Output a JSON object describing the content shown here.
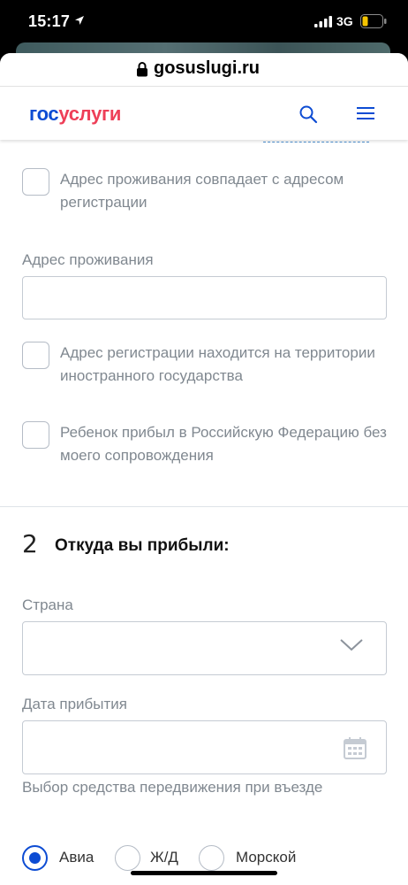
{
  "status_bar": {
    "time": "15:17",
    "network": "3G"
  },
  "browser": {
    "url": "gosuslugi.ru"
  },
  "header": {
    "logo_part1": "гос",
    "logo_part2": "услуги"
  },
  "form": {
    "checkbox_same_address": "Адрес проживания совпадает с адресом регистрации",
    "residence_label": "Адрес проживания",
    "residence_value": "",
    "checkbox_foreign": "Адрес регистрации находится на территории иностранного государства",
    "checkbox_unaccompanied": "Ребенок прибыл в Российскую Федерацию без моего сопровождения",
    "section2_number": "2",
    "section2_title": "Откуда вы прибыли:",
    "country_label": "Страна",
    "country_value": "",
    "arrival_date_label": "Дата прибытия",
    "arrival_date_value": "",
    "transport_label": "Выбор средства передвижения при въезде",
    "transport_options": [
      {
        "label": "Авиа",
        "selected": true
      },
      {
        "label": "Ж/Д",
        "selected": false
      },
      {
        "label": "Морской",
        "selected": false
      }
    ]
  },
  "colors": {
    "brand_blue": "#0d4cd3",
    "brand_red": "#ee3f58"
  }
}
